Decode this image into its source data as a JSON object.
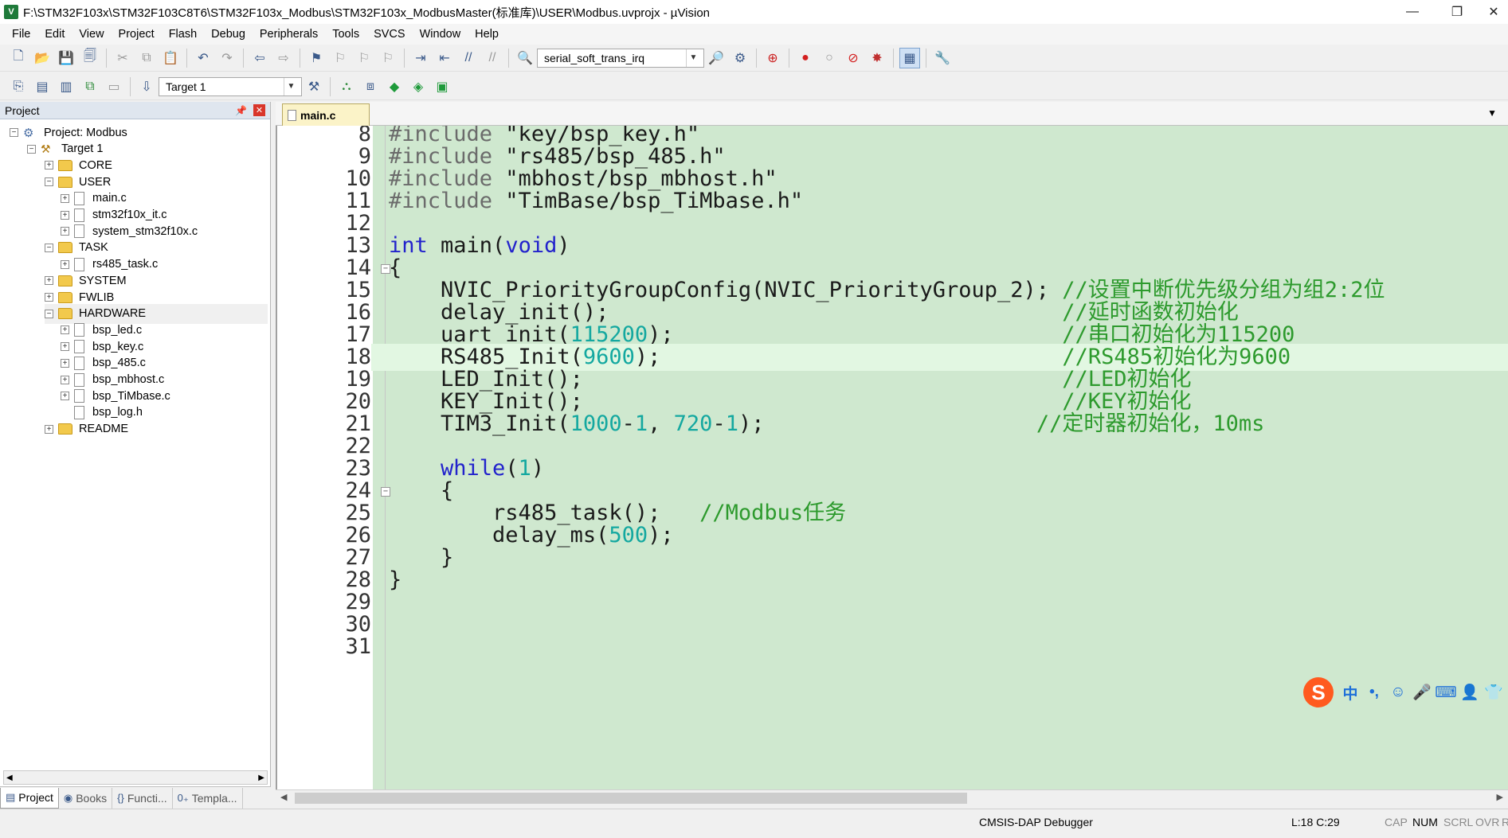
{
  "window": {
    "title": "F:\\STM32F103x\\STM32F103C8T6\\STM32F103x_Modbus\\STM32F103x_ModbusMaster(标准库)\\USER\\Modbus.uvprojx - µVision",
    "app_icon_letter": "V",
    "minimize": "—",
    "restore": "❐",
    "close": "✕"
  },
  "menu": [
    "File",
    "Edit",
    "View",
    "Project",
    "Flash",
    "Debug",
    "Peripherals",
    "Tools",
    "SVCS",
    "Window",
    "Help"
  ],
  "toolbar1": {
    "function_combo_value": "serial_soft_trans_irq"
  },
  "toolbar2": {
    "target_combo_value": "Target 1"
  },
  "project_panel": {
    "title": "Project",
    "tree": [
      {
        "label": "Project: Modbus",
        "kind": "project",
        "level": 0,
        "expander": "⊟"
      },
      {
        "label": "Target 1",
        "kind": "target",
        "level": 1,
        "expander": "⊟"
      },
      {
        "label": "CORE",
        "kind": "folder",
        "level": 2,
        "expander": "+"
      },
      {
        "label": "USER",
        "kind": "folder",
        "level": 2,
        "expander": "−"
      },
      {
        "label": "main.c",
        "kind": "file",
        "level": 3,
        "expander": "+"
      },
      {
        "label": "stm32f10x_it.c",
        "kind": "file",
        "level": 3,
        "expander": "+"
      },
      {
        "label": "system_stm32f10x.c",
        "kind": "file",
        "level": 3,
        "expander": "+"
      },
      {
        "label": "TASK",
        "kind": "folder",
        "level": 2,
        "expander": "−"
      },
      {
        "label": "rs485_task.c",
        "kind": "file",
        "level": 3,
        "expander": "+"
      },
      {
        "label": "SYSTEM",
        "kind": "folder",
        "level": 2,
        "expander": "+"
      },
      {
        "label": "FWLIB",
        "kind": "folder",
        "level": 2,
        "expander": "+"
      },
      {
        "label": "HARDWARE",
        "kind": "folder",
        "level": 2,
        "expander": "−",
        "selected": true
      },
      {
        "label": "bsp_led.c",
        "kind": "file",
        "level": 3,
        "expander": "+"
      },
      {
        "label": "bsp_key.c",
        "kind": "file",
        "level": 3,
        "expander": "+"
      },
      {
        "label": "bsp_485.c",
        "kind": "file",
        "level": 3,
        "expander": "+"
      },
      {
        "label": "bsp_mbhost.c",
        "kind": "file",
        "level": 3,
        "expander": "+"
      },
      {
        "label": "bsp_TiMbase.c",
        "kind": "file",
        "level": 3,
        "expander": "+"
      },
      {
        "label": "bsp_log.h",
        "kind": "file",
        "level": 3,
        "expander": ""
      },
      {
        "label": "README",
        "kind": "folder",
        "level": 2,
        "expander": "+"
      }
    ],
    "tabs": [
      {
        "label": "Project",
        "icon": "▤",
        "active": true
      },
      {
        "label": "Books",
        "icon": "◉",
        "active": false
      },
      {
        "label": "Functi...",
        "icon": "{}",
        "active": false
      },
      {
        "label": "Templa...",
        "icon": "0₊",
        "active": false
      }
    ]
  },
  "editor": {
    "tab_label": "main.c",
    "menu_arrow": "▼",
    "current_line": 18,
    "lines": [
      {
        "n": "8",
        "fold": "",
        "tokens": [
          {
            "t": "#include",
            "c": "pre"
          },
          {
            "t": " \"key/bsp_key.h\"",
            "c": "str"
          }
        ]
      },
      {
        "n": "9",
        "fold": "",
        "tokens": [
          {
            "t": "#include",
            "c": "pre"
          },
          {
            "t": " \"rs485/bsp_485.h\"",
            "c": "str"
          }
        ]
      },
      {
        "n": "10",
        "fold": "",
        "tokens": [
          {
            "t": "#include",
            "c": "pre"
          },
          {
            "t": " \"mbhost/bsp_mbhost.h\"",
            "c": "str"
          }
        ]
      },
      {
        "n": "11",
        "fold": "",
        "tokens": [
          {
            "t": "#include",
            "c": "pre"
          },
          {
            "t": " \"TimBase/bsp_TiMbase.h\"",
            "c": "str"
          }
        ]
      },
      {
        "n": "12",
        "fold": "",
        "tokens": []
      },
      {
        "n": "13",
        "fold": "",
        "tokens": [
          {
            "t": "int",
            "c": "kw"
          },
          {
            "t": " main(",
            "c": "txt"
          },
          {
            "t": "void",
            "c": "kw"
          },
          {
            "t": ")",
            "c": "txt"
          }
        ]
      },
      {
        "n": "14",
        "fold": "−",
        "tokens": [
          {
            "t": "{",
            "c": "txt"
          }
        ]
      },
      {
        "n": "15",
        "fold": "",
        "tokens": [
          {
            "t": "    NVIC_PriorityGroupConfig(NVIC_PriorityGroup_2); ",
            "c": "txt"
          },
          {
            "t": "//设置中断优先级分组为组2:2位",
            "c": "cmt"
          }
        ]
      },
      {
        "n": "16",
        "fold": "",
        "tokens": [
          {
            "t": "    delay_init();                                   ",
            "c": "txt"
          },
          {
            "t": "//延时函数初始化",
            "c": "cmt"
          }
        ]
      },
      {
        "n": "17",
        "fold": "",
        "tokens": [
          {
            "t": "    uart_init(",
            "c": "txt"
          },
          {
            "t": "115200",
            "c": "num"
          },
          {
            "t": ");                              ",
            "c": "txt"
          },
          {
            "t": "//串口初始化为115200",
            "c": "cmt"
          }
        ]
      },
      {
        "n": "18",
        "fold": "",
        "tokens": [
          {
            "t": "    RS485_Init(",
            "c": "txt"
          },
          {
            "t": "9600",
            "c": "num"
          },
          {
            "t": ");                               ",
            "c": "txt"
          },
          {
            "t": "//RS485初始化为9600",
            "c": "cmt"
          }
        ]
      },
      {
        "n": "19",
        "fold": "",
        "tokens": [
          {
            "t": "    LED_Init();                                     ",
            "c": "txt"
          },
          {
            "t": "//LED初始化",
            "c": "cmt"
          }
        ]
      },
      {
        "n": "20",
        "fold": "",
        "tokens": [
          {
            "t": "    KEY_Init();                                     ",
            "c": "txt"
          },
          {
            "t": "//KEY初始化",
            "c": "cmt"
          }
        ]
      },
      {
        "n": "21",
        "fold": "",
        "tokens": [
          {
            "t": "    TIM3_Init(",
            "c": "txt"
          },
          {
            "t": "1000",
            "c": "num"
          },
          {
            "t": "-",
            "c": "txt"
          },
          {
            "t": "1",
            "c": "num"
          },
          {
            "t": ", ",
            "c": "txt"
          },
          {
            "t": "720",
            "c": "num"
          },
          {
            "t": "-",
            "c": "txt"
          },
          {
            "t": "1",
            "c": "num"
          },
          {
            "t": ");                     ",
            "c": "txt"
          },
          {
            "t": "//定时器初始化，10ms",
            "c": "cmt"
          }
        ]
      },
      {
        "n": "22",
        "fold": "",
        "tokens": []
      },
      {
        "n": "23",
        "fold": "",
        "tokens": [
          {
            "t": "    ",
            "c": "txt"
          },
          {
            "t": "while",
            "c": "kw"
          },
          {
            "t": "(",
            "c": "txt"
          },
          {
            "t": "1",
            "c": "num"
          },
          {
            "t": ")",
            "c": "txt"
          }
        ]
      },
      {
        "n": "24",
        "fold": "−",
        "tokens": [
          {
            "t": "    {",
            "c": "txt"
          }
        ]
      },
      {
        "n": "25",
        "fold": "",
        "tokens": [
          {
            "t": "        rs485_task();   ",
            "c": "txt"
          },
          {
            "t": "//Modbus任务",
            "c": "cmt"
          }
        ]
      },
      {
        "n": "26",
        "fold": "",
        "tokens": [
          {
            "t": "        delay_ms(",
            "c": "txt"
          },
          {
            "t": "500",
            "c": "num"
          },
          {
            "t": ");",
            "c": "txt"
          }
        ]
      },
      {
        "n": "27",
        "fold": "",
        "tokens": [
          {
            "t": "    }",
            "c": "txt"
          }
        ]
      },
      {
        "n": "28",
        "fold": "",
        "tokens": [
          {
            "t": "}",
            "c": "txt"
          }
        ]
      },
      {
        "n": "29",
        "fold": "",
        "tokens": []
      },
      {
        "n": "30",
        "fold": "",
        "tokens": []
      },
      {
        "n": "31",
        "fold": "",
        "tokens": []
      }
    ]
  },
  "statusbar": {
    "debugger": "CMSIS-DAP Debugger",
    "position": "L:18 C:29",
    "indicators": [
      {
        "label": "CAP",
        "active": false
      },
      {
        "label": "NUM",
        "active": true
      },
      {
        "label": "SCRL",
        "active": false
      },
      {
        "label": "OVR",
        "active": false
      },
      {
        "label": "R",
        "active": false
      }
    ]
  },
  "ime": {
    "logo": "S",
    "lang": "中",
    "items": [
      "•,",
      "☺",
      "🎤",
      "⌨",
      "👤",
      "👕"
    ]
  },
  "colors": {
    "editor_bg": "#cfe8cf",
    "current_line_bg": "#e2f7e2",
    "keyword": "#2222cc",
    "number": "#14a8a0",
    "comment": "#2d9a2d",
    "preprocessor": "#6b6b6b"
  }
}
